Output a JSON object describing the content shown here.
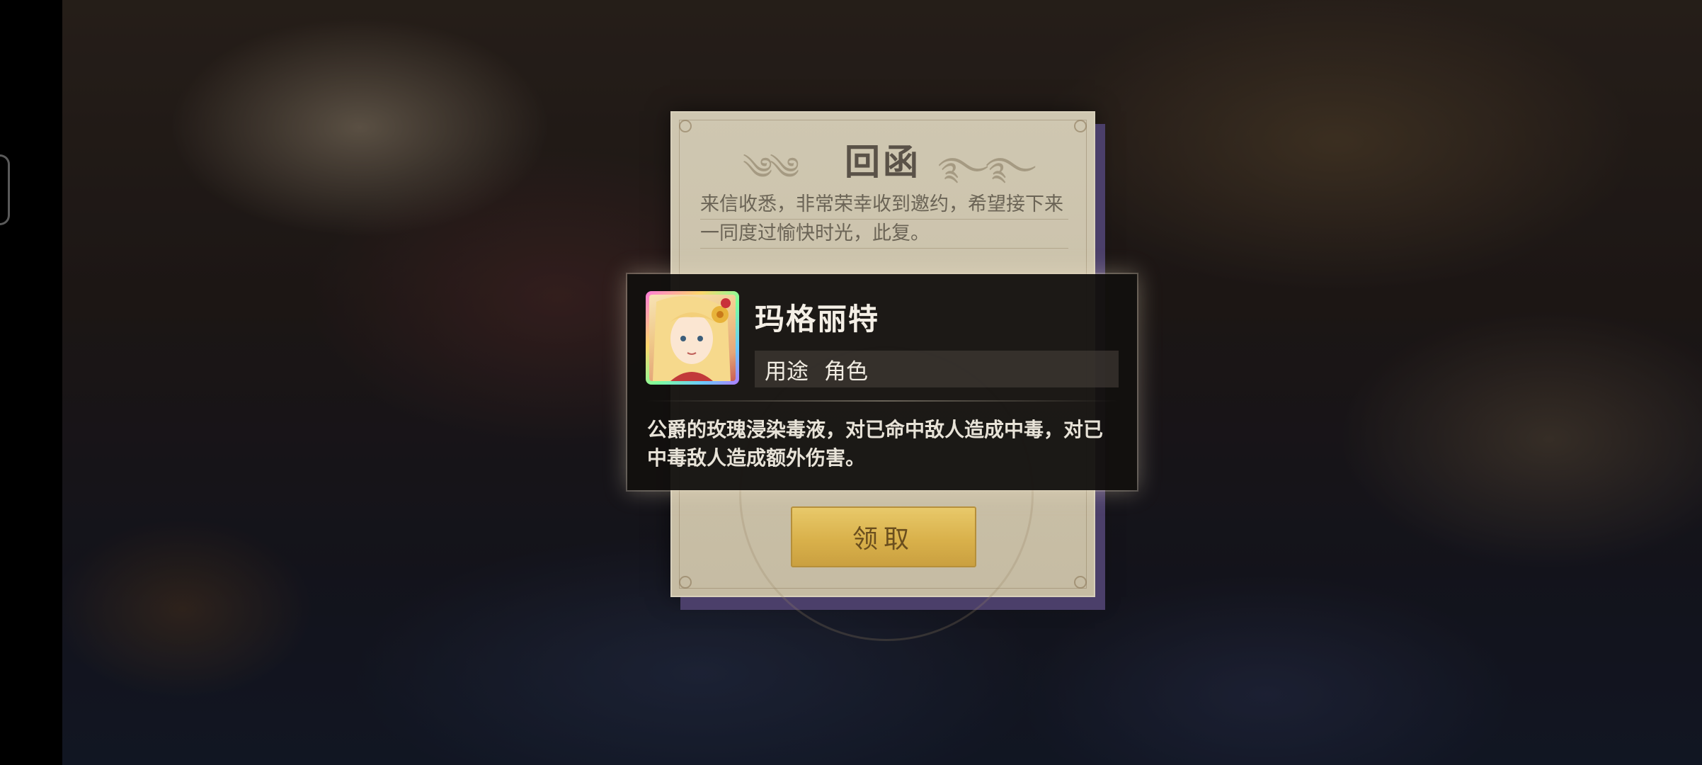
{
  "letter": {
    "title": "回函",
    "body_line1": "来信收悉，非常荣幸收到邀约，希望接下来",
    "body_line2": "一同度过愉快时光，此复。",
    "claim_label": "领取"
  },
  "tooltip": {
    "name": "玛格丽特",
    "usage_label": "用途",
    "usage_value": "角色",
    "description": "公爵的玫瑰浸染毒液，对已命中敌人造成中毒，对已中毒敌人造成额外伤害。",
    "avatar_icon": "character-portrait-margaret"
  },
  "colors": {
    "letter_paper": "#cfc7b1",
    "letter_shadow": "#4b3f6a",
    "button_gold": "#d9b14b",
    "tooltip_bg": "#12100e"
  }
}
